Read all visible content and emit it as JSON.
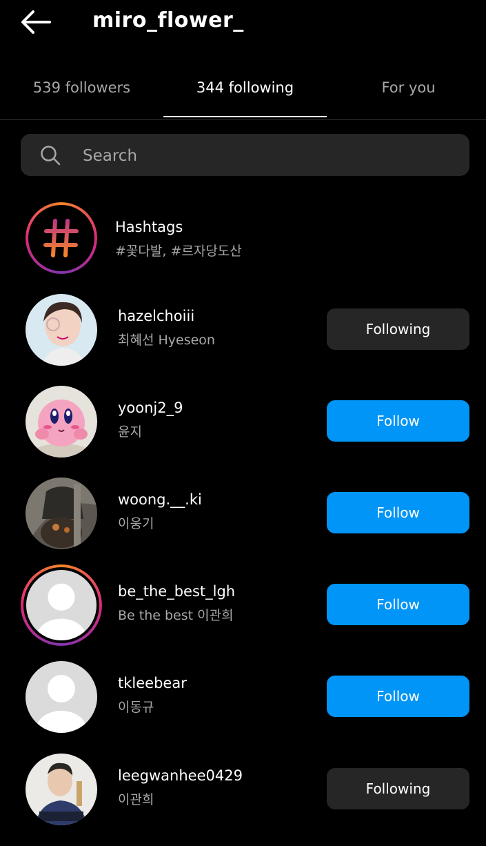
{
  "header": {
    "title": "miro_flower_",
    "back_icon": "arrow-left-icon"
  },
  "tabs": [
    {
      "label": "539 followers",
      "active": false
    },
    {
      "label": "344 following",
      "active": true
    },
    {
      "label": "For you",
      "active": false
    }
  ],
  "search": {
    "placeholder": "Search",
    "icon": "search-icon"
  },
  "hashtags": {
    "title": "Hashtags",
    "subtitle": "#꽃다발, #르자당도산",
    "icon": "hashtag-icon"
  },
  "users": [
    {
      "username": "hazelchoiii",
      "fullname": "최혜선 Hyeseon",
      "button": "Following",
      "avatar": "photo-woman",
      "story_ring": false
    },
    {
      "username": "yoonj2_9",
      "fullname": "윤지",
      "button": "Follow",
      "avatar": "kirby-figure",
      "story_ring": false
    },
    {
      "username": "woong.__.ki",
      "fullname": "이웅기",
      "button": "Follow",
      "avatar": "dark-photo",
      "story_ring": false
    },
    {
      "username": "be_the_best_lgh",
      "fullname": "Be the best 이관희",
      "button": "Follow",
      "avatar": "default-avatar",
      "story_ring": true
    },
    {
      "username": "tkleebear",
      "fullname": "이동규",
      "button": "Follow",
      "avatar": "default-avatar",
      "story_ring": false
    },
    {
      "username": "leegwanhee0429",
      "fullname": "이관희",
      "button": "Following",
      "avatar": "illustrated-man",
      "story_ring": false
    }
  ],
  "colors": {
    "background": "#000000",
    "follow_blue": "#0095f6",
    "following_gray": "#262626",
    "secondary_text": "#a8a8a8"
  }
}
